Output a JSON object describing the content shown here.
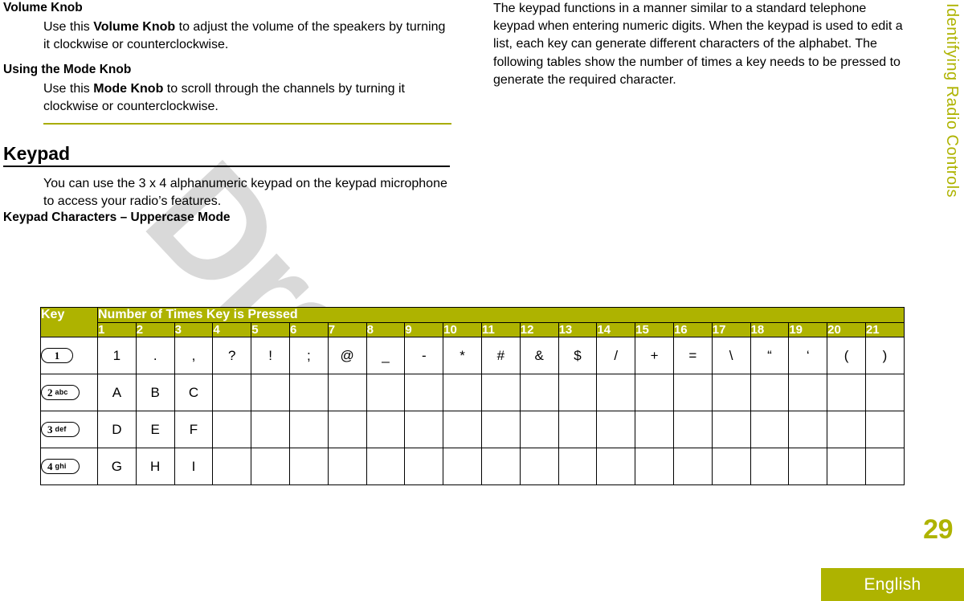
{
  "side_tab": {
    "label": "Identifying Radio Controls"
  },
  "page_number": "29",
  "footer": {
    "language": "English"
  },
  "watermark": {
    "text": "Draft"
  },
  "left_column": {
    "volume_heading": "Volume Knob",
    "volume_body_prefix": "Use this ",
    "volume_body_bold": "Volume Knob",
    "volume_body_suffix": " to adjust the volume of the speakers by turning it clockwise or counterclockwise.",
    "mode_heading": "Using the Mode Knob",
    "mode_body_prefix": "Use this ",
    "mode_body_bold": "Mode Knob",
    "mode_body_suffix": " to scroll through the channels by turning it clockwise or counterclockwise.",
    "chapter_heading": "Keypad",
    "keypad_body": "You can use the 3 x 4 alphanumeric keypad on the keypad microphone to access your radio’s features.",
    "table_title": "Keypad Characters – Uppercase Mode"
  },
  "right_column": {
    "paragraph": "The keypad functions in a manner similar to a standard telephone keypad when entering numeric digits. When the keypad is used to edit a list, each key can generate different characters of the alphabet. The following tables show the number of times a key needs to be pressed to generate the required character."
  },
  "table": {
    "key_header": "Key",
    "press_header": "Number of Times Key is Pressed",
    "press_columns": [
      "1",
      "2",
      "3",
      "4",
      "5",
      "6",
      "7",
      "8",
      "9",
      "10",
      "11",
      "12",
      "13",
      "14",
      "15",
      "16",
      "17",
      "18",
      "19",
      "20",
      "21"
    ],
    "rows": [
      {
        "key_icon": "key-1-icon",
        "key_number": "1",
        "key_letters": "",
        "characters": [
          "1",
          ".",
          ",",
          "?",
          "!",
          ";",
          "@",
          "_",
          "-",
          "*",
          "#",
          "&",
          "$",
          "/",
          "+",
          "=",
          "\\",
          "“",
          "‘",
          "(",
          ")"
        ]
      },
      {
        "key_icon": "key-2-abc-icon",
        "key_number": "2",
        "key_letters": "abc",
        "characters": [
          "A",
          "B",
          "C",
          "",
          "",
          "",
          "",
          "",
          "",
          "",
          "",
          "",
          "",
          "",
          "",
          "",
          "",
          "",
          "",
          "",
          ""
        ]
      },
      {
        "key_icon": "key-3-def-icon",
        "key_number": "3",
        "key_letters": "def",
        "characters": [
          "D",
          "E",
          "F",
          "",
          "",
          "",
          "",
          "",
          "",
          "",
          "",
          "",
          "",
          "",
          "",
          "",
          "",
          "",
          "",
          "",
          ""
        ]
      },
      {
        "key_icon": "key-4-ghi-icon",
        "key_number": "4",
        "key_letters": "ghi",
        "characters": [
          "G",
          "H",
          "I",
          "",
          "",
          "",
          "",
          "",
          "",
          "",
          "",
          "",
          "",
          "",
          "",
          "",
          "",
          "",
          "",
          "",
          ""
        ]
      }
    ]
  },
  "colors": {
    "accent_olive": "#aeb300",
    "rule_olive": "#a8ad00",
    "text_black": "#000000",
    "watermark_gray": "#d9d9d9"
  }
}
